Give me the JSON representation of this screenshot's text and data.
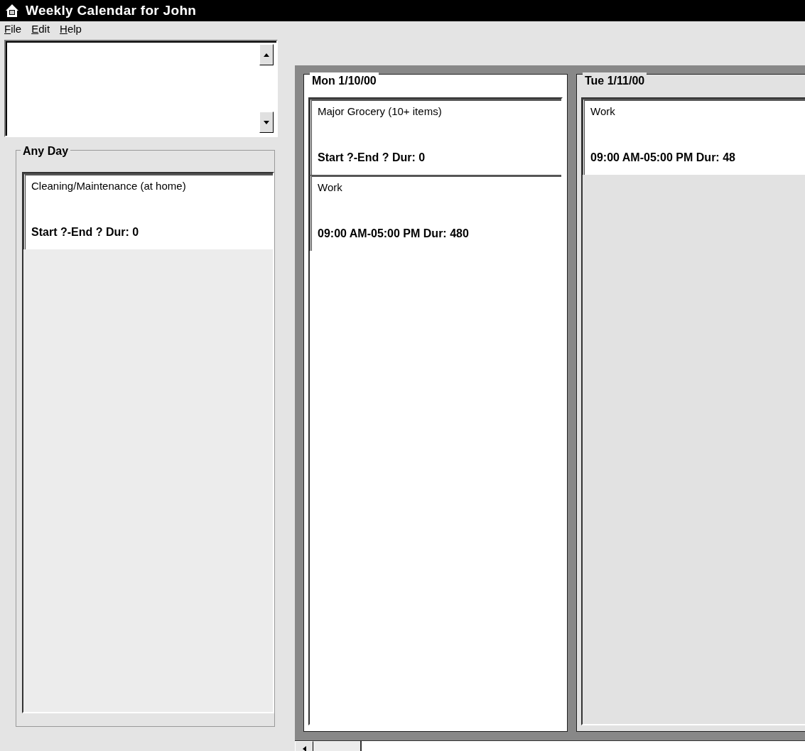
{
  "window": {
    "title": "Weekly Calendar for John"
  },
  "menu": [
    {
      "label": "File"
    },
    {
      "label": "Edit"
    },
    {
      "label": "Help"
    }
  ],
  "any_day": {
    "title": "Any Day",
    "events": [
      {
        "title": "Cleaning/Maintenance (at home)",
        "time": "Start ?-End ? Dur: 0"
      }
    ]
  },
  "days": [
    {
      "title": "Mon 1/10/00",
      "selected": true,
      "events": [
        {
          "title": "Major Grocery (10+ items)",
          "time": "Start ?-End ? Dur: 0"
        },
        {
          "title": "Work",
          "time": "09:00 AM-05:00 PM Dur: 480"
        }
      ]
    },
    {
      "title": "Tue 1/11/00",
      "selected": false,
      "events": [
        {
          "title": "Work",
          "time": "09:00 AM-05:00 PM Dur: 48"
        }
      ]
    }
  ]
}
